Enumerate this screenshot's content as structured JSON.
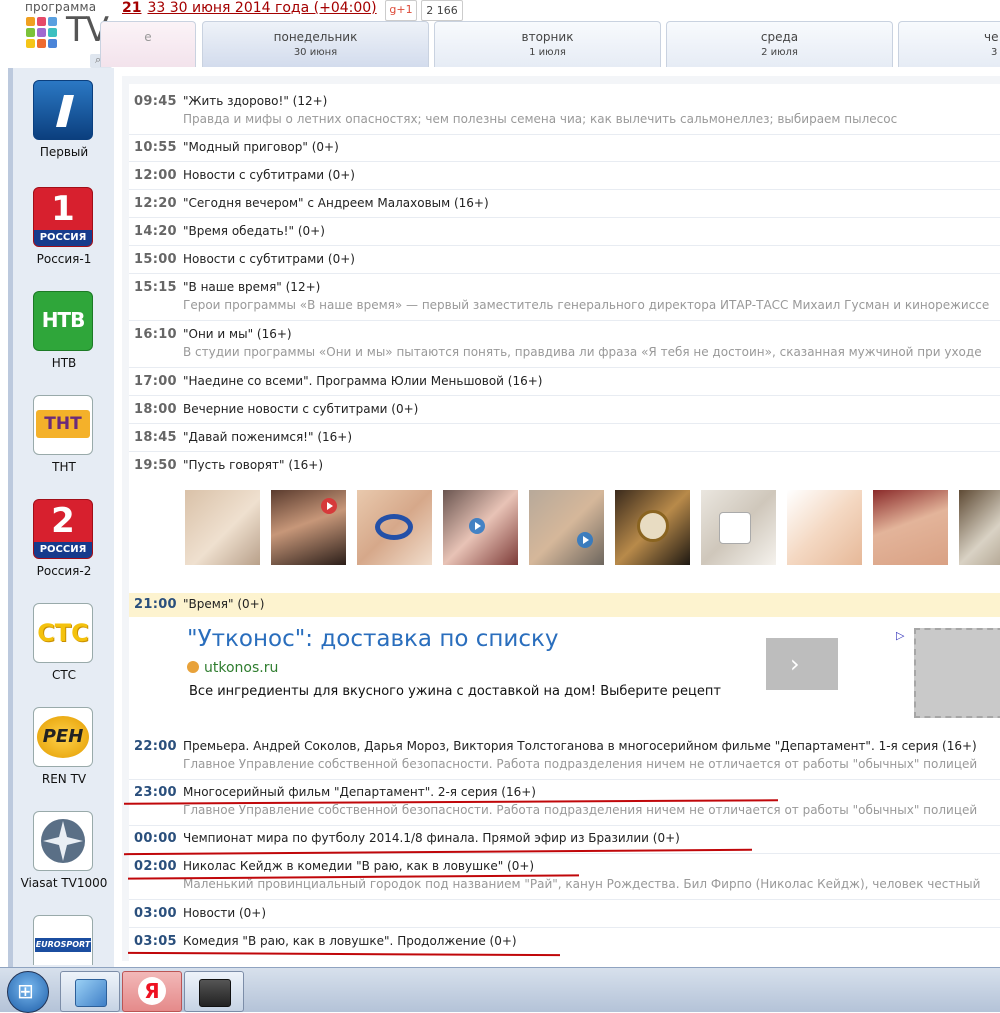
{
  "header": {
    "logo_top_text": "программа",
    "logo_tv_text": "TV",
    "search_icon_glyph": "⌕",
    "date_num": "21",
    "date_text": "33 30 июня 2014 года (+04:00)",
    "gplus_label": "g+1",
    "gplus_count": "2 166"
  },
  "tabs": [
    {
      "name": "е",
      "date": ""
    },
    {
      "name": "понедельник",
      "date": "30 июня",
      "active": true
    },
    {
      "name": "вторник",
      "date": "1 июля"
    },
    {
      "name": "среда",
      "date": "2 июля"
    },
    {
      "name": "че",
      "date": "3"
    }
  ],
  "channels": [
    {
      "name": "Первый",
      "logo": "first-channel-logo",
      "active": true
    },
    {
      "name": "Россия-1",
      "logo": "russia-1-logo"
    },
    {
      "name": "НТВ",
      "logo": "ntv-logo"
    },
    {
      "name": "ТНТ",
      "logo": "tnt-logo"
    },
    {
      "name": "Россия-2",
      "logo": "russia-2-logo"
    },
    {
      "name": "СТС",
      "logo": "sts-logo"
    },
    {
      "name": "REN TV",
      "logo": "ren-tv-logo"
    },
    {
      "name": "Viasat TV1000",
      "logo": "viasat-tv1000-logo"
    },
    {
      "name": "",
      "logo": "eurosport-logo"
    }
  ],
  "logo_text": {
    "russia1_digit": "1",
    "russia1_word": "РОССИЯ",
    "ntv": "НТВ",
    "tnt": "ТНТ",
    "russia2_digit": "2",
    "russia2_word": "РОССИЯ",
    "sts": "СТС",
    "ren": "РЕН",
    "eurosport": "EUROSPORT"
  },
  "schedule_top": [
    {
      "time": "09:45",
      "title": "\"Жить здорово!\" (12+)",
      "desc": "Правда и мифы о летних опасностях; чем полезны семена чиа; как вылечить сальмонеллез; выбираем пылесос"
    },
    {
      "time": "10:55",
      "title": "\"Модный приговор\" (0+)"
    },
    {
      "time": "12:00",
      "title": "Новости с субтитрами (0+)"
    },
    {
      "time": "12:20",
      "title": "\"Сегодня вечером\" с Андреем Малаховым (16+)"
    },
    {
      "time": "14:20",
      "title": "\"Время обедать!\" (0+)"
    },
    {
      "time": "15:00",
      "title": "Новости с субтитрами (0+)"
    },
    {
      "time": "15:15",
      "title": "\"В наше время\" (12+)",
      "desc": "Герои программы «В наше время» — первый заместитель генерального директора ИТАР-ТАСС Михаил Гусман и кинорежиссе"
    },
    {
      "time": "16:10",
      "title": "\"Они и мы\" (16+)",
      "desc": "В студии программы «Они и мы» пытаются понять, правдива ли фраза «Я тебя не достоин», сказанная мужчиной при уходе"
    },
    {
      "time": "17:00",
      "title": "\"Наедине со всеми\". Программа Юлии Меньшовой (16+)"
    },
    {
      "time": "18:00",
      "title": "Вечерние новости с субтитрами (0+)"
    },
    {
      "time": "18:45",
      "title": "\"Давай поженимся!\" (16+)"
    },
    {
      "time": "19:50",
      "title": "\"Пусть говорят\" (16+)"
    }
  ],
  "highlight": {
    "time": "21:00",
    "title": "\"Время\" (0+)"
  },
  "ad": {
    "headline": "\"Утконос\": доставка по списку",
    "url": "utkonos.ru",
    "text": "Все ингредиенты для вкусного ужина с доставкой на дом! Выберите рецепт",
    "arrow": "›",
    "marker": "▷"
  },
  "schedule_bottom": [
    {
      "time": "22:00",
      "title": "Премьера. Андрей Соколов, Дарья Мороз, Виктория Толстоганова в многосерийном фильме \"Департамент\". 1-я серия (16+)",
      "desc": "Главное Управление собственной безопасности. Работа подразделения ничем не отличается от работы \"обычных\" полицей"
    },
    {
      "time": "23:00",
      "title": "Многосерийный фильм \"Департамент\". 2-я серия (16+)",
      "desc": "Главное Управление собственной безопасности. Работа подразделения ничем не отличается от работы \"обычных\" полицей"
    },
    {
      "time": "00:00",
      "title": "Чемпионат мира по футболу 2014.1/8 финала. Прямой эфир из Бразилии (0+)"
    },
    {
      "time": "02:00",
      "title": "Николас Кейдж в комедии \"В раю, как в ловушке\" (0+)",
      "desc": "Маленький провинциальный городок под названием \"Рай\", канун Рождества. Бил Фирпо (Николас Кейдж), человек честный"
    },
    {
      "time": "03:00",
      "title": "Новости (0+)"
    },
    {
      "time": "03:05",
      "title": "Комедия \"В раю, как в ловушке\". Продолжение (0+)"
    }
  ],
  "taskbar": {
    "start_glyph": "⊞",
    "items": [
      "control-panel-icon",
      "yandex-browser-icon",
      "tv-tuner-icon"
    ],
    "yandex_letter": "Я"
  },
  "colors": {
    "accent_blue": "#2a4f7c",
    "highlight_row": "#fdf3cf",
    "underline_red": "#c0070a",
    "ad_link": "#2a6ebd"
  }
}
